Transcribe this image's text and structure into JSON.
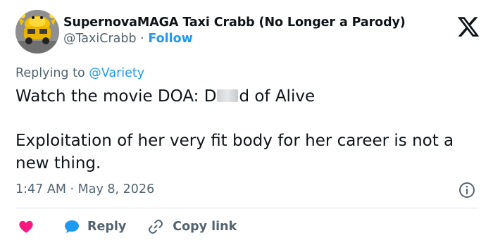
{
  "tweet": {
    "display_name": "SupernovaMAGA Taxi Crabb (No Longer a Parody)",
    "handle": "@TaxiCrabb",
    "separator": "·",
    "follow_label": "Follow",
    "replying_prefix": "Replying to",
    "replying_to": "@Variety",
    "text_line1_before": "Watch the movie DOA: D",
    "text_line1_after": "d of Alive",
    "text_para2": "Exploitation of her very fit body for her career is not a new thing.",
    "time": "1:47 AM",
    "date": "May 8, 2026",
    "meta_separator": "·"
  },
  "actions": {
    "reply_label": "Reply",
    "copy_link_label": "Copy link"
  },
  "colors": {
    "accent": "#1d9bf0",
    "like": "#f91880",
    "text": "#0f1419",
    "muted": "#536471"
  },
  "icons": {
    "avatar": "crab-taxi-avatar",
    "brand": "x-logo-icon",
    "info": "info-icon",
    "like": "heart-icon",
    "reply": "speech-bubble-icon",
    "copy": "link-icon"
  }
}
